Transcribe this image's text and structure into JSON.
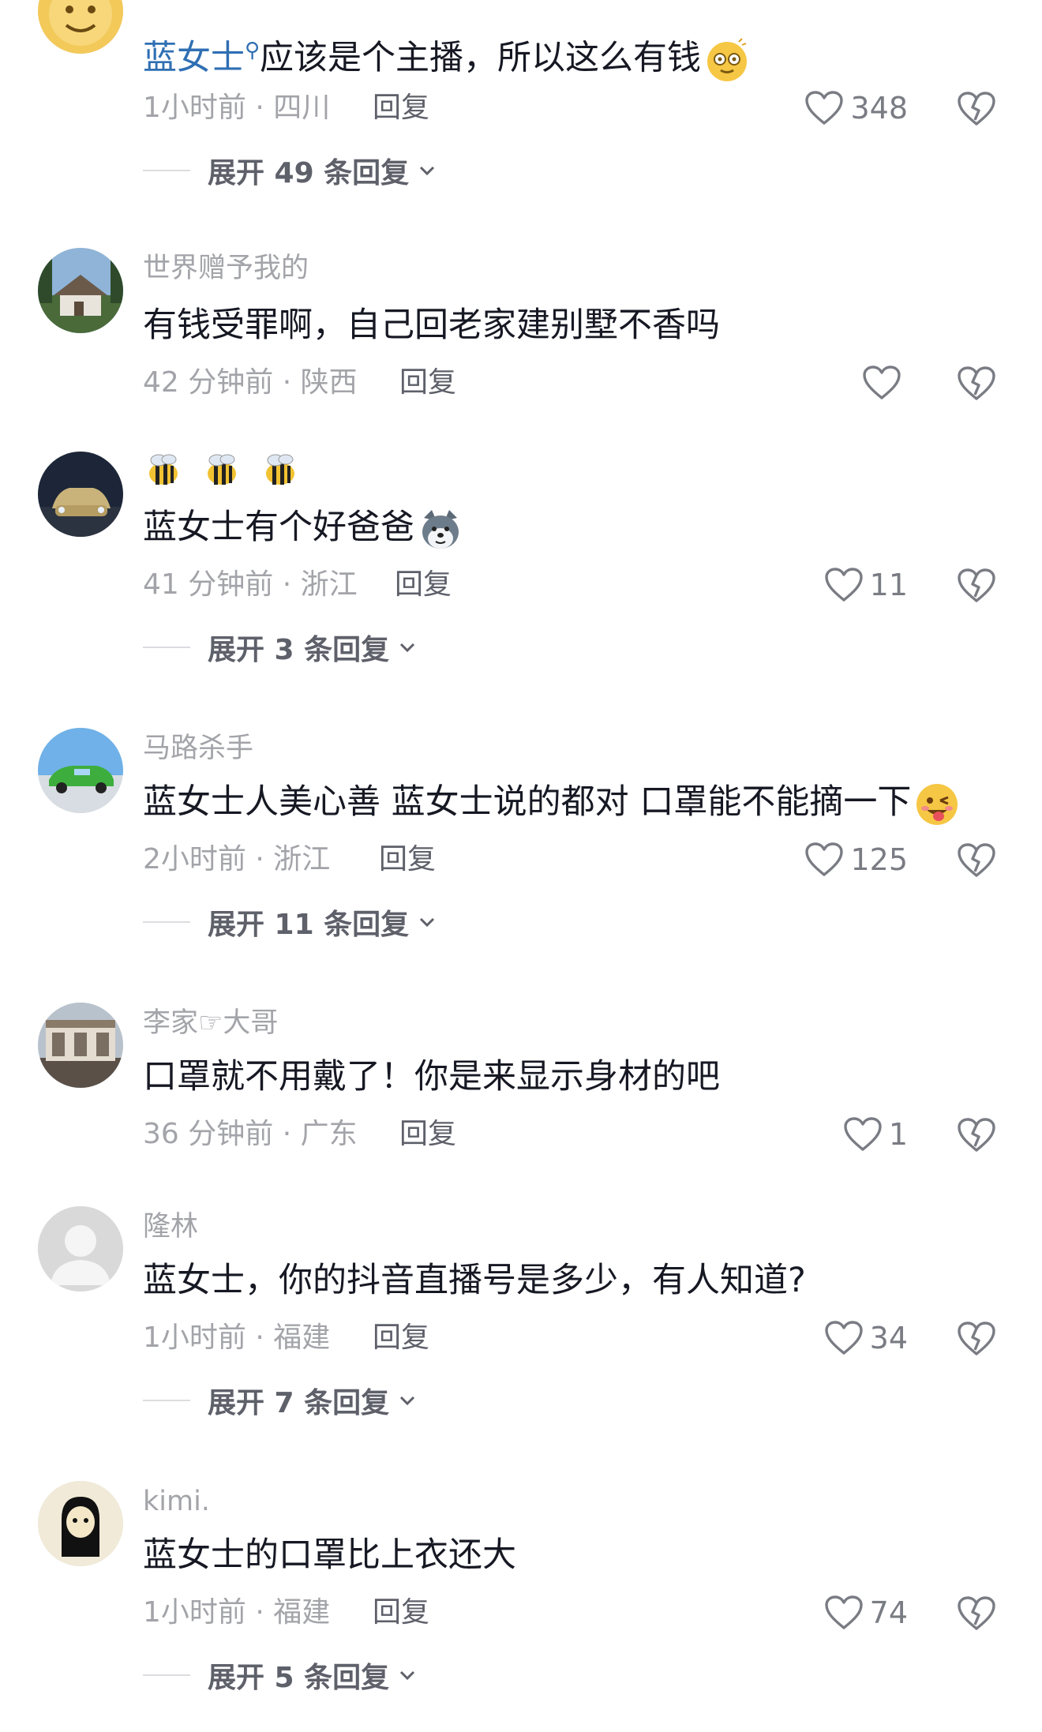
{
  "comments": [
    {
      "user": "",
      "mention": "蓝女士",
      "text": "应该是个主播，所以这么有钱",
      "time": "1小时前",
      "location": "四川",
      "reply": "回复",
      "likes": "348",
      "expand": "展开 49 条回复",
      "emoji": "dizzy-face-emoji"
    },
    {
      "user": "世界赠予我的",
      "text": "有钱受罪啊，自己回老家建别墅不香吗",
      "time": "42 分钟前",
      "location": "陕西",
      "reply": "回复",
      "likes": ""
    },
    {
      "user_icons": [
        "bee-icon",
        "bee-icon",
        "bee-icon"
      ],
      "text": "蓝女士有个好爸爸",
      "time": "41 分钟前",
      "location": "浙江",
      "reply": "回复",
      "likes": "11",
      "expand": "展开 3 条回复",
      "emoji": "husky-dog-emoji"
    },
    {
      "user": "马路杀手",
      "text": "蓝女士人美心善 蓝女士说的都对 口罩能不能摘一下",
      "time": "2小时前",
      "location": "浙江",
      "reply": "回复",
      "likes": "125",
      "expand": "展开 11 条回复",
      "emoji": "winking-tongue-emoji"
    },
    {
      "user": "李家☞大哥",
      "text": "口罩就不用戴了！你是来显示身材的吧",
      "time": "36 分钟前",
      "location": "广东",
      "reply": "回复",
      "likes": "1"
    },
    {
      "user": "隆林",
      "text": "蓝女士，你的抖音直播号是多少，有人知道?",
      "time": "1小时前",
      "location": "福建",
      "reply": "回复",
      "likes": "34",
      "expand": "展开 7 条回复"
    },
    {
      "user": "kimi.",
      "text": "蓝女士的口罩比上衣还大",
      "time": "1小时前",
      "location": "福建",
      "reply": "回复",
      "likes": "74",
      "expand": "展开 5 条回复"
    }
  ],
  "colors": {
    "text": "#161823",
    "muted": "#a3a4a9",
    "mention": "#2f6fb3",
    "reply": "#5e606a"
  },
  "separator": " · "
}
